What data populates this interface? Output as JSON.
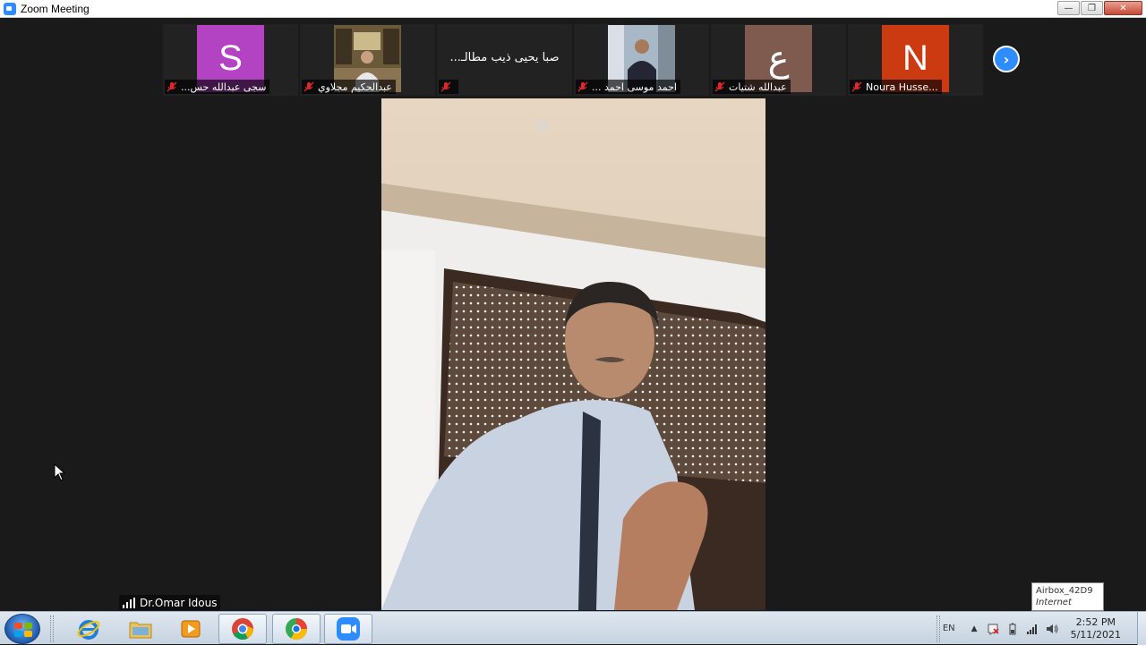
{
  "window": {
    "title": "Zoom Meeting",
    "minimize": "—",
    "maximize": "❐",
    "close": "✕"
  },
  "participants": [
    {
      "name": "...سجى عبدالله حس",
      "avatar_letter": "S",
      "avatar_color": "#b443c4",
      "type": "letter"
    },
    {
      "name": "عبدالحكيم مجلاوي",
      "type": "photo"
    },
    {
      "name": "",
      "display_name": "...صبا يحيى ذيب مطالـ",
      "type": "text"
    },
    {
      "name": "... احمد موسى احمد",
      "type": "photo"
    },
    {
      "name": "عبدالله شتيات",
      "avatar_letter": "ع",
      "avatar_color": "#7e5a4f",
      "type": "letter"
    },
    {
      "name": "Noura Husse...",
      "avatar_letter": "N",
      "avatar_color": "#cc3a12",
      "type": "letter"
    }
  ],
  "next_page": "›",
  "active_speaker": {
    "name": "Dr.Omar Idous"
  },
  "tooltip": {
    "network": "Airbox_42D9",
    "status": "Internet access"
  },
  "taskbar": {
    "apps": [
      {
        "name": "internet-explorer"
      },
      {
        "name": "file-explorer"
      },
      {
        "name": "media-player"
      },
      {
        "name": "chrome",
        "active": true
      },
      {
        "name": "edge",
        "active": true
      },
      {
        "name": "zoom",
        "active": true
      }
    ],
    "language": "EN",
    "tray_arrow": "▲",
    "time": "2:52 PM",
    "date": "5/11/2021"
  },
  "colors": {
    "zoom_blue": "#2d8cff",
    "mute_red": "#e02828"
  }
}
